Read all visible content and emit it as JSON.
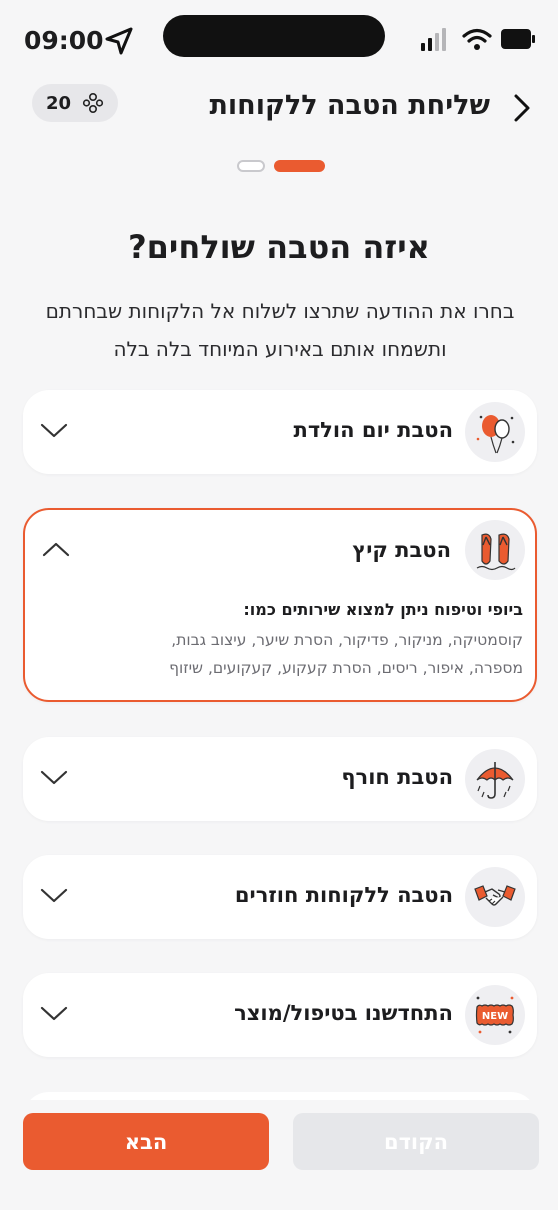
{
  "status_bar": {
    "time": "09:00"
  },
  "header": {
    "title": "שליחת הטבה ללקוחות",
    "count": "20"
  },
  "question": "איזה הטבה שולחים?",
  "subtitle_lines": [
    "בחרו את ההודעה שתרצו לשלוח אל הלקוחות שבחרתם",
    "ותשמחו אותם באירוע המיוחד בלה בלה"
  ],
  "cards": [
    {
      "label": "הטבת יום הולדת",
      "icon": "balloons-icon",
      "expanded": false
    },
    {
      "label": "הטבת קיץ",
      "icon": "flip-flops-icon",
      "expanded": true,
      "description_heading": "ביופי וטיפוח ניתן למצוא שירותים כמו:",
      "description_body": "קוסמטיקה, מניקור, פדיקור, הסרת שיער, עיצוב גבות, מספרה, איפור, ריסים, הסרת קעקוע, קעקועים, שיזוף"
    },
    {
      "label": "הטבת חורף",
      "icon": "umbrella-icon",
      "expanded": false
    },
    {
      "label": "הטבה ללקוחות חוזרים",
      "icon": "handshake-icon",
      "expanded": false
    },
    {
      "label": "התחדשנו בטיפול/מוצר",
      "icon": "new-badge-icon",
      "expanded": false,
      "badge_text": "NEW"
    }
  ],
  "footer": {
    "next_label": "הבא",
    "prev_label": "הקודם"
  },
  "colors": {
    "accent": "#ea5b30",
    "disabled": "#e6e7ea",
    "background": "#f6f6f7"
  }
}
